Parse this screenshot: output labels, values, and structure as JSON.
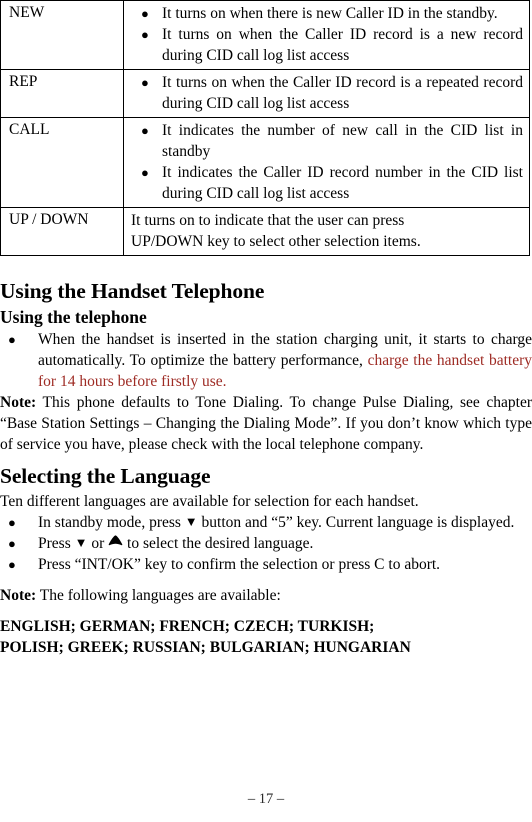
{
  "table": {
    "rows": [
      {
        "label": "NEW",
        "type": "bulleted",
        "items": [
          "It turns on when there is new Caller ID in the standby.",
          "It turns on when the Caller ID record is a new record during CID call log list access"
        ]
      },
      {
        "label": "REP",
        "type": "bulleted",
        "items": [
          "It turns on when the Caller ID record is a repeated record during CID call log list access"
        ]
      },
      {
        "label": "CALL",
        "type": "bulleted",
        "items": [
          "It indicates the number of new call in the CID list in standby",
          "It indicates the Caller ID record number in the CID list during CID call log list access"
        ]
      },
      {
        "label": "UP / DOWN",
        "type": "plain",
        "text_line1": "It turns on to indicate that the user can press",
        "text_line2": "UP/DOWN key to select other selection items."
      }
    ]
  },
  "sections": {
    "handset": {
      "heading": "Using the Handset Telephone",
      "subheading": "Using the telephone",
      "bullet_charging": {
        "text_black": "When the handset is inserted in the station charging unit, it starts to charge automatically. To optimize the battery performance, ",
        "text_red": "charge the handset battery for 14 hours before firstly use."
      },
      "note": {
        "label": "Note:",
        "text": " This phone defaults to Tone Dialing. To change Pulse Dialing, see chapter “Base Station Settings – Changing the Dialing Mode”. If you don’t know which type of service you have, please check with the local telephone company."
      }
    },
    "language": {
      "heading": "Selecting the Language",
      "intro": "Ten different languages are available for selection for each handset.",
      "bullets": [
        {
          "before": "In standby mode, press ",
          "icon": "arrow-down-icon",
          "after": " button and “5” key. Current language is displayed."
        },
        {
          "before": "Press ",
          "icon": "arrow-down-icon",
          "middle": " or ",
          "icon2": "arrow-up-icon",
          "after": " to select the desired language."
        },
        {
          "text": "Press “INT/OK” key to confirm the selection or press C to abort."
        }
      ],
      "note": {
        "label": "Note:",
        "text": " The following languages are available:"
      },
      "languages_line1": "ENGLISH; GERMAN; FRENCH; CZECH; TURKISH;",
      "languages_line2": "POLISH; GREEK; RUSSIAN; BULGARIAN; HUNGARIAN"
    }
  },
  "footer": {
    "page_number": "– 17 –"
  },
  "colors": {
    "red_highlight": "#9E2B24",
    "text": "#000000",
    "rule": "#000000"
  },
  "icons": {
    "bullet": "●",
    "arrow_down": "▼",
    "arrow_up": "▲"
  }
}
